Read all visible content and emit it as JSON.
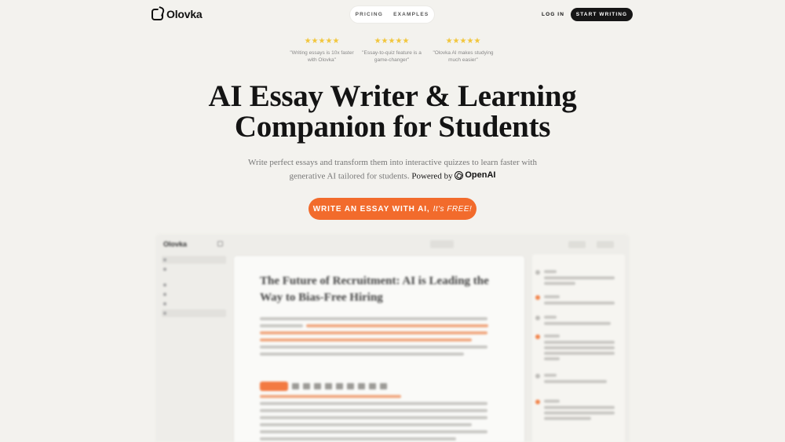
{
  "header": {
    "logo_text": "Olovka",
    "nav": [
      {
        "label": "PRICING"
      },
      {
        "label": "EXAMPLES"
      }
    ],
    "login_label": "LOG IN",
    "start_label": "START WRITING"
  },
  "reviews": [
    {
      "stars": "★★★★★",
      "text": "\"Writing essays is 10x faster with Olovka\""
    },
    {
      "stars": "★★★★★",
      "text": "\"Essay-to-quiz feature is a game-changer\""
    },
    {
      "stars": "★★★★★",
      "text": "\"Olovka AI makes studying much easier\""
    }
  ],
  "hero": {
    "title_line1": "AI Essay Writer & Learning",
    "title_line2": "Companion for Students",
    "subtitle": "Write perfect essays and transform them into interactive quizzes to learn faster with generative AI tailored for students.",
    "powered_by": "Powered by",
    "openai_label": "OpenAI",
    "cta_main": "WRITE AN ESSAY WITH AI,",
    "cta_emphasis": "It's FREE!"
  },
  "preview": {
    "logo_text": "Olovka",
    "doc_title": "The Future of Recruitment: AI is Leading the Way to Bias-Free Hiring"
  },
  "colors": {
    "background": "#f3f2ee",
    "accent": "#f26b2c",
    "star": "#f2c63c",
    "dark_button": "#161616"
  }
}
